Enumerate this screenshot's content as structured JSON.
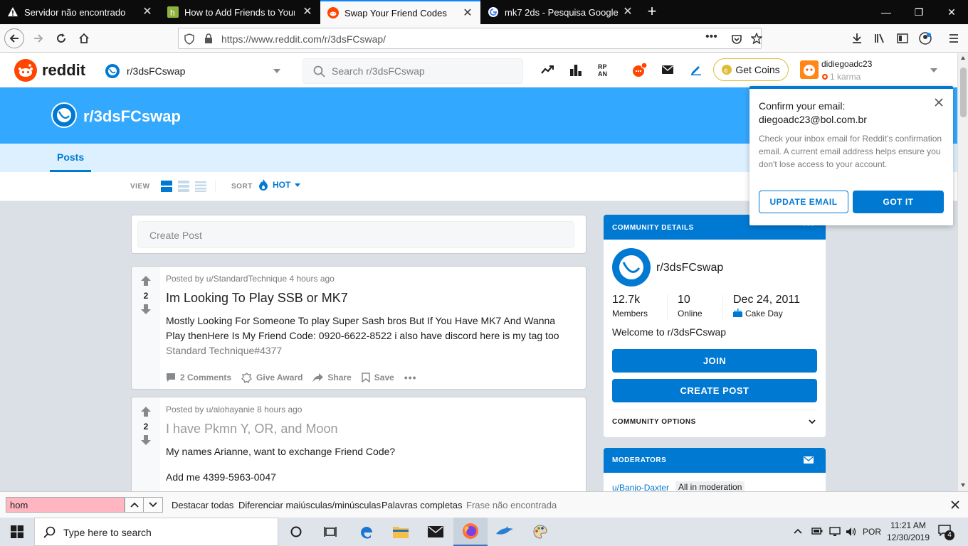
{
  "browser": {
    "tabs": [
      {
        "title": "Servidor não encontrado",
        "icon": "warning-icon"
      },
      {
        "title": "How to Add Friends to Your Ni",
        "icon": "site-icon"
      },
      {
        "title": "Swap Your Friend Codes",
        "icon": "reddit-icon"
      },
      {
        "title": "mk7 2ds - Pesquisa Google",
        "icon": "google-icon"
      }
    ],
    "url": "https://www.reddit.com/r/3dsFCswap/"
  },
  "reddit": {
    "logo_text": "reddit",
    "community_dropdown": "r/3dsFCswap",
    "search_placeholder": "Search r/3dsFCswap",
    "coins_label": "Get Coins",
    "username": "didiegoadc23",
    "karma": "1 karma",
    "banner_title": "r/3dsFCswap",
    "posts_tab": "Posts",
    "view_label": "VIEW",
    "sort_label": "SORT",
    "sort_value": "HOT",
    "create_post_placeholder": "Create Post",
    "posts": [
      {
        "meta": "Posted by u/StandardTechnique 4 hours ago",
        "votes": "2",
        "title": "Im Looking To Play SSB or MK7",
        "body1": "Mostly Looking For Someone To play Super Sash bros But If You Have MK7 And Wanna",
        "body2": "Play thenHere Is My Friend Code: 0920-6622-8522 i also have discord here is my tag too",
        "body3": "Standard Technique#4377",
        "comments": "2 Comments",
        "award": "Give Award",
        "share": "Share",
        "save": "Save"
      },
      {
        "meta": "Posted by u/alohayanie 8 hours ago",
        "votes": "2",
        "title": "I have Pkmn Y, OR, and Moon",
        "body1": "My names Arianne, want to exchange Friend Code?",
        "body2": "Add me 4399-5963-0047"
      }
    ],
    "community": {
      "header": "COMMUNITY DETAILS",
      "name": "r/3dsFCswap",
      "members_value": "12.7k",
      "members_label": "Members",
      "online_value": "10",
      "online_label": "Online",
      "created_value": "Dec 24, 2011",
      "created_label": "Cake Day",
      "welcome": "Welcome to r/3dsFCswap",
      "join": "JOIN",
      "create_post": "CREATE POST",
      "options": "COMMUNITY OPTIONS"
    },
    "moderators": {
      "header": "MODERATORS",
      "mod1": "u/Banjo-Daxter",
      "mod1_flair": "All in moderation"
    },
    "popup": {
      "title": "Confirm your email:",
      "email": "diegoadc23@bol.com.br",
      "body": "Check your inbox email for Reddit's confirmation email. A current email address helps ensure you don't lose access to your account.",
      "update": "UPDATE EMAIL",
      "gotit": "GOT IT"
    }
  },
  "findbar": {
    "query": "hom",
    "highlight_all": "Destacar todas",
    "match_case": "Diferenciar maiúsculas/minúsculas",
    "whole_words": "Palavras completas",
    "status": "Frase não encontrada"
  },
  "taskbar": {
    "search_placeholder": "Type here to search",
    "lang": "POR",
    "time": "11:21 AM",
    "date": "12/30/2019",
    "notifications": "4"
  },
  "colors": {
    "reddit_orange": "#ff4500",
    "reddit_blue": "#0079d3",
    "banner": "#33a8ff",
    "coin_gold": "#ddbd37"
  }
}
